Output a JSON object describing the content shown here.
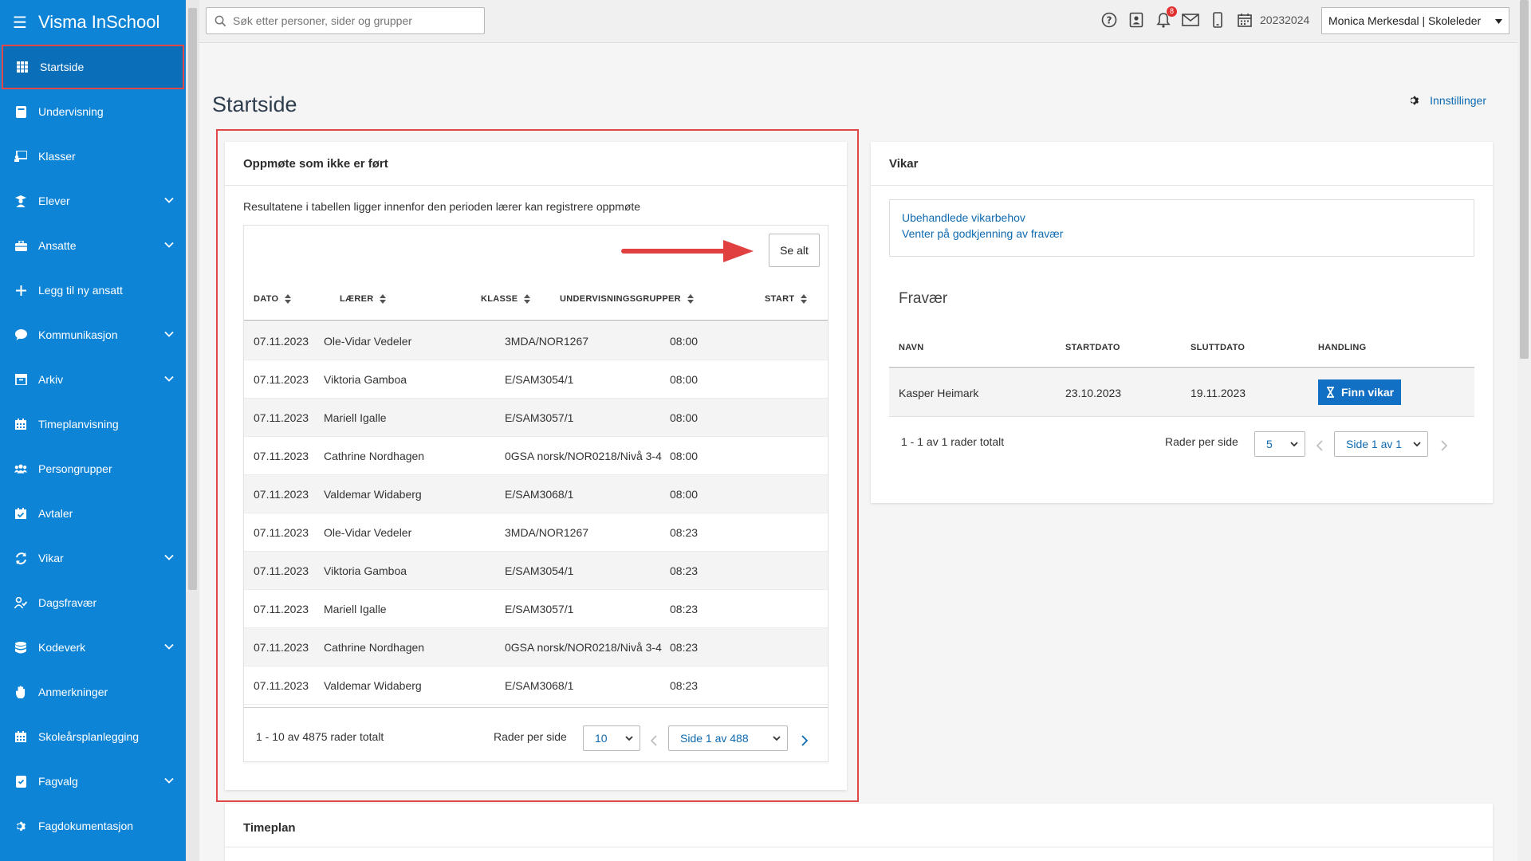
{
  "app": {
    "name": "Visma InSchool"
  },
  "sidebar": {
    "items": [
      {
        "label": "Startside",
        "icon": "grid-icon",
        "expandable": false,
        "active": true
      },
      {
        "label": "Undervisning",
        "icon": "book-icon",
        "expandable": false
      },
      {
        "label": "Klasser",
        "icon": "presentation-icon",
        "expandable": false
      },
      {
        "label": "Elever",
        "icon": "student-icon",
        "expandable": true
      },
      {
        "label": "Ansatte",
        "icon": "briefcase-icon",
        "expandable": true
      },
      {
        "label": "Legg til ny ansatt",
        "icon": "plus-icon",
        "expandable": false
      },
      {
        "label": "Kommunikasjon",
        "icon": "chat-icon",
        "expandable": true
      },
      {
        "label": "Arkiv",
        "icon": "archive-icon",
        "expandable": true
      },
      {
        "label": "Timeplanvisning",
        "icon": "calendar-icon",
        "expandable": false
      },
      {
        "label": "Persongrupper",
        "icon": "group-icon",
        "expandable": false
      },
      {
        "label": "Avtaler",
        "icon": "calendar-check-icon",
        "expandable": false
      },
      {
        "label": "Vikar",
        "icon": "swap-icon",
        "expandable": true
      },
      {
        "label": "Dagsfravær",
        "icon": "user-check-icon",
        "expandable": false
      },
      {
        "label": "Kodeverk",
        "icon": "database-icon",
        "expandable": true
      },
      {
        "label": "Anmerkninger",
        "icon": "hand-icon",
        "expandable": false
      },
      {
        "label": "Skoleårsplanlegging",
        "icon": "calendar-icon",
        "expandable": false
      },
      {
        "label": "Fagvalg",
        "icon": "book-check-icon",
        "expandable": true
      },
      {
        "label": "Fagdokumentasjon",
        "icon": "gear-icon",
        "expandable": false
      }
    ]
  },
  "topbar": {
    "search_placeholder": "Søk etter personer, sider og grupper",
    "notification_count": "8",
    "school_year": "20232024",
    "user": "Monica Merkesdal | Skoleleder"
  },
  "page": {
    "title": "Startside",
    "settings_label": "Innstillinger"
  },
  "oppmote": {
    "title": "Oppmøte som ikke er ført",
    "subtext": "Resultatene i tabellen ligger innenfor den perioden lærer kan registrere oppmøte",
    "see_all_label": "Se alt",
    "columns": {
      "dato": "DATO",
      "laerer": "LÆRER",
      "klasse": "KLASSE",
      "grupper": "UNDERVISNINGSGRUPPER",
      "start": "START"
    },
    "rows": [
      {
        "dato": "07.11.2023",
        "laerer": "Ole-Vidar Vedeler",
        "klasse": "",
        "gruppe": "3MDA/NOR1267",
        "start": "08:00"
      },
      {
        "dato": "07.11.2023",
        "laerer": "Viktoria Gamboa",
        "klasse": "",
        "gruppe": "E/SAM3054/1",
        "start": "08:00"
      },
      {
        "dato": "07.11.2023",
        "laerer": "Mariell Igalle",
        "klasse": "",
        "gruppe": "E/SAM3057/1",
        "start": "08:00"
      },
      {
        "dato": "07.11.2023",
        "laerer": "Cathrine Nordhagen",
        "klasse": "",
        "gruppe": "0GSA norsk/NOR0218/Nivå 3-4",
        "start": "08:00"
      },
      {
        "dato": "07.11.2023",
        "laerer": "Valdemar Widaberg",
        "klasse": "",
        "gruppe": "E/SAM3068/1",
        "start": "08:00"
      },
      {
        "dato": "07.11.2023",
        "laerer": "Ole-Vidar Vedeler",
        "klasse": "",
        "gruppe": "3MDA/NOR1267",
        "start": "08:23"
      },
      {
        "dato": "07.11.2023",
        "laerer": "Viktoria Gamboa",
        "klasse": "",
        "gruppe": "E/SAM3054/1",
        "start": "08:23"
      },
      {
        "dato": "07.11.2023",
        "laerer": "Mariell Igalle",
        "klasse": "",
        "gruppe": "E/SAM3057/1",
        "start": "08:23"
      },
      {
        "dato": "07.11.2023",
        "laerer": "Cathrine Nordhagen",
        "klasse": "",
        "gruppe": "0GSA norsk/NOR0218/Nivå 3-4",
        "start": "08:23"
      },
      {
        "dato": "07.11.2023",
        "laerer": "Valdemar Widaberg",
        "klasse": "",
        "gruppe": "E/SAM3068/1",
        "start": "08:23"
      }
    ],
    "footer": {
      "total_text": "1 - 10 av 4875 rader totalt",
      "rows_per_page_label": "Rader per side",
      "rows_per_page_value": "10",
      "page_value": "Side 1 av 488"
    }
  },
  "vikar": {
    "title": "Vikar",
    "links": [
      "Ubehandlede vikarbehov",
      "Venter på godkjenning av fravær"
    ],
    "fravar": {
      "title": "Fravær",
      "columns": {
        "navn": "NAVN",
        "start": "STARTDATO",
        "slutt": "SLUTTDATO",
        "handling": "HANDLING"
      },
      "rows": [
        {
          "navn": "Kasper Heimark",
          "start": "23.10.2023",
          "slutt": "19.11.2023",
          "action": "Finn vikar"
        }
      ],
      "footer": {
        "total_text": "1 - 1 av 1 rader totalt",
        "rows_per_page_label": "Rader per side",
        "rows_per_page_value": "5",
        "page_value": "Side 1 av 1"
      }
    }
  },
  "timeplan": {
    "title": "Timeplan"
  },
  "colors": {
    "sidebar": "#0e84d6",
    "accent": "#1170c4",
    "highlight": "#e04848",
    "link": "#0e6ab0"
  }
}
